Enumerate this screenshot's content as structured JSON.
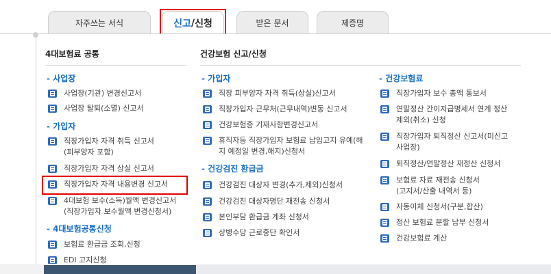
{
  "tabs": [
    {
      "label": "자주쓰는 서식"
    },
    {
      "label_a": "신고",
      "label_sep": "/",
      "label_b": "신청"
    },
    {
      "label": "받은 문서"
    },
    {
      "label": "제증명"
    }
  ],
  "left": {
    "title": "4대보험료 공통",
    "sections": [
      {
        "title": "- 사업장",
        "items": [
          "사업장(기관) 변경신고서",
          "사업장 탈퇴(소멸) 신고서"
        ]
      },
      {
        "title": "- 가입자",
        "items": [
          "직장가입자 자격 취득 신고서\n(피부양자 포함)",
          "직장가입자 자격 상실 신고서",
          "직장가입자 자격 내용변경 신고서",
          "4대보험 보수(소득)월액 변경신고서\n(직장가입자 보수월액 변경신청서)"
        ]
      },
      {
        "title": "- 4대보험공통신청",
        "items": [
          "보험료 환급금 조회,신청",
          "EDI 고지신청"
        ]
      }
    ]
  },
  "right": {
    "title": "건강보험 신고/신청",
    "mid_sections": [
      {
        "title": "- 가입자",
        "items": [
          "직장 피부양자 자격 취득(상실)신고서",
          "직장가입자 근무처(근무내역)변동 신고서",
          "건강보험증 기재사항변경신고서",
          "휴직자등 직장가입자 보험료 납입고지 유예(해\n지 예정일 변경,해지)신청서"
        ]
      },
      {
        "title": "- 건강검진 환급금",
        "items": [
          "건강검진 대상자 변경(추가,제외)신청서",
          "건강검진 대상자명단 재전송 신청서",
          "본인부담 환급금 계좌 신청서",
          "상병수당 근로중단 확인서"
        ]
      }
    ],
    "far_sections": [
      {
        "title": "- 건강보험료",
        "items": [
          "직장가입자 보수 총액 통보서",
          "연말정산 간이지급명세서 연계 정산\n제외(취소) 신청",
          "직장가입자 퇴직정산 신고서(미신고\n사업장)",
          "퇴직정산/연말정산 재정산 신청서",
          "보험료 자료 재전송 신청서\n(고지서/산출 내역서 등)",
          "자동이체 신청서(구분,합산)",
          "정산 보험료 분할 납부 신청서",
          "건강보험료 계산"
        ]
      }
    ]
  }
}
